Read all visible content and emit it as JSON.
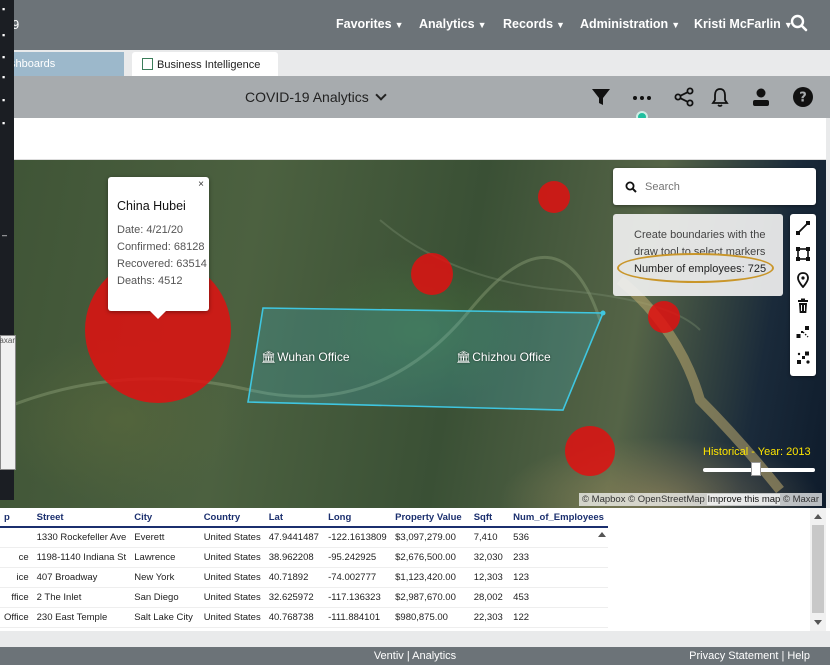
{
  "app": {
    "brand_fragment": "9"
  },
  "nav": {
    "menus": [
      {
        "label": "Favorites"
      },
      {
        "label": "Analytics"
      },
      {
        "label": "Records"
      },
      {
        "label": "Administration"
      },
      {
        "label": "Kristi McFarlin"
      }
    ],
    "search_icon": "search-icon"
  },
  "tabs": [
    {
      "label": "shboards",
      "active": false
    },
    {
      "label": "Business Intelligence",
      "active": true
    }
  ],
  "toolbar": {
    "title": "COVID-19 Analytics",
    "icons": [
      "filter-icon",
      "more-icon",
      "share-icon",
      "bell-icon",
      "user-icon",
      "help-icon"
    ]
  },
  "map": {
    "popup": {
      "close": "×",
      "title": "China Hubei",
      "date": "Date: 4/21/20",
      "confirmed": "Confirmed: 68128",
      "recovered": "Recovered: 63514",
      "deaths": "Deaths: 4512"
    },
    "offices": [
      "Wuhan Office",
      "Chizhou Office"
    ],
    "search_placeholder": "Search",
    "info_text": "Create boundaries with the draw tool to select markers",
    "employee_count": "Number of employees: 725",
    "draw_tools": [
      "line-icon",
      "polygon-icon",
      "marker-icon",
      "trash-icon",
      "pan-icon",
      "select-points-icon"
    ],
    "historical_label": "Historical - Year: 2013",
    "historical_slider_fraction": 0.47,
    "attribution_prefix": "© Mapbox © OpenStreetMap",
    "attribution_improve": "Improve this map",
    "attribution_suffix": "© Maxar",
    "left_panel_maxar": "Maxar",
    "colors": {
      "marker": "#e01010",
      "boundary": "#3fc6e0",
      "highlight": "#c9962a"
    }
  },
  "table": {
    "columns": [
      "p",
      "Street",
      "City",
      "Country",
      "Lat",
      "Long",
      "Property Value",
      "Sqft",
      "Num_of_Employees"
    ],
    "rows": [
      [
        "",
        "1330 Rockefeller Ave",
        "Everett",
        "United States",
        "47.9441487",
        "-122.1613809",
        "$3,097,279.00",
        "7,410",
        "536"
      ],
      [
        "ce",
        "1198-1140 Indiana St",
        "Lawrence",
        "United States",
        "38.962208",
        "-95.242925",
        "$2,676,500.00",
        "32,030",
        "233"
      ],
      [
        "ice",
        "407 Broadway",
        "New York",
        "United States",
        "40.71892",
        "-74.002777",
        "$1,123,420.00",
        "12,303",
        "123"
      ],
      [
        "ffice",
        "2 The Inlet",
        "San Diego",
        "United States",
        "32.625972",
        "-117.136323",
        "$2,987,670.00",
        "28,002",
        "453"
      ],
      [
        "Office",
        "230 East Temple",
        "Salt Lake City",
        "United States",
        "40.768738",
        "-111.884101",
        "$980,875.00",
        "22,303",
        "122"
      ]
    ]
  },
  "footer": {
    "center": "Ventiv | Analytics",
    "right": "Privacy Statement | Help"
  }
}
